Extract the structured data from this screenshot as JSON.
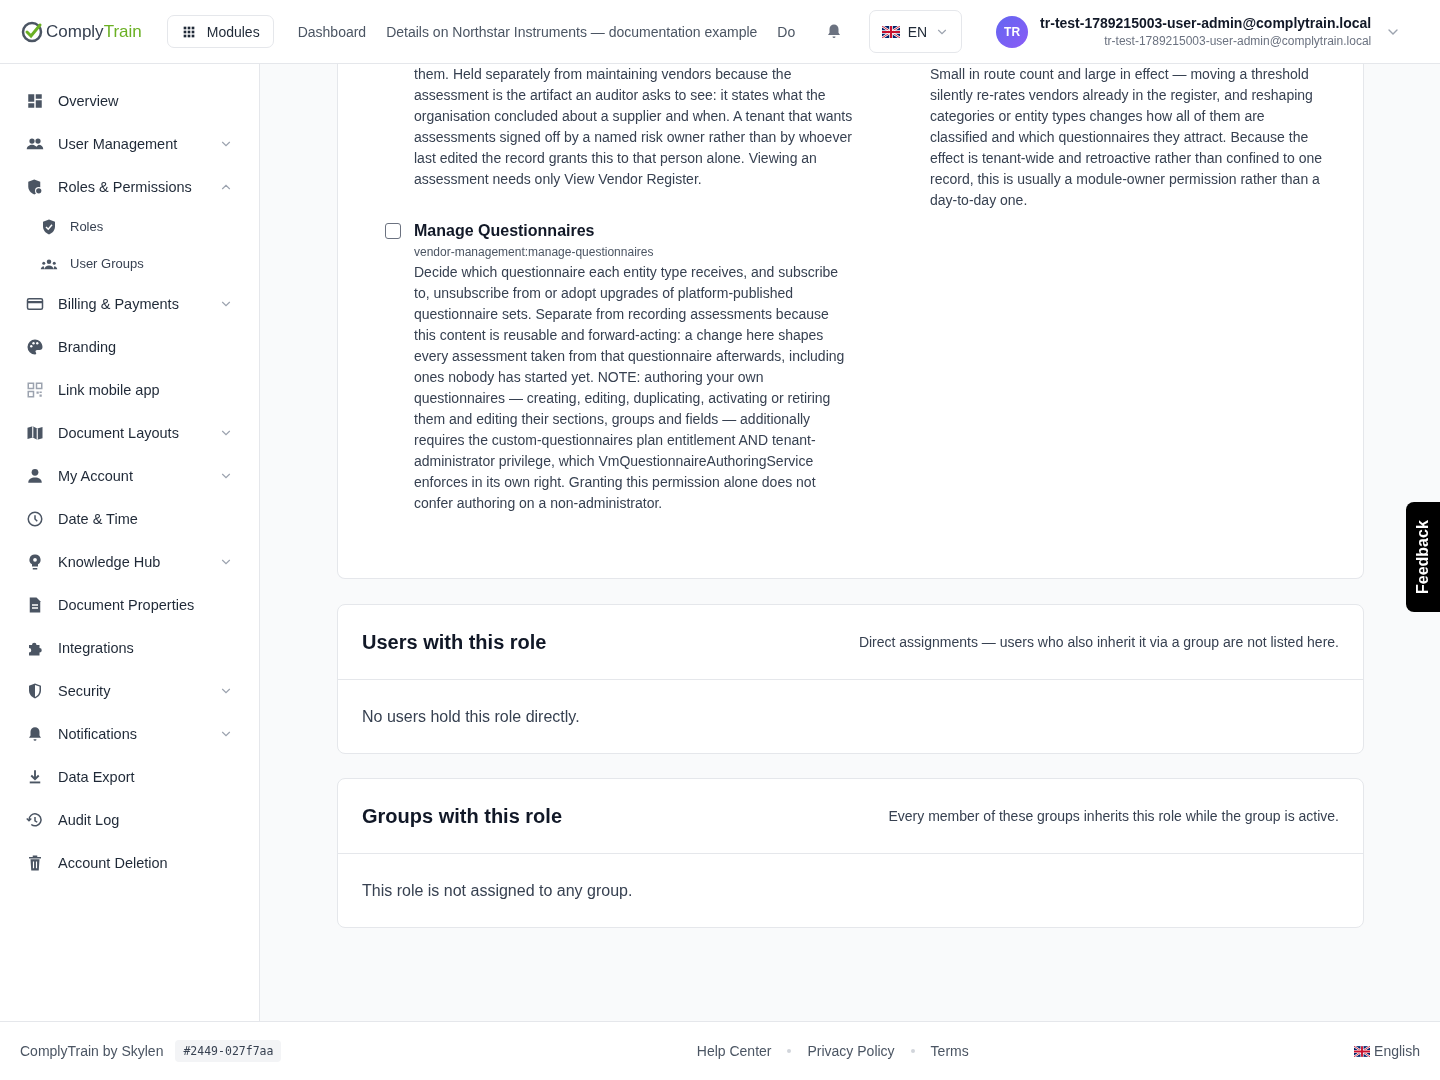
{
  "header": {
    "logo": {
      "dark_part": "Comply",
      "accent_part": "Train"
    },
    "modules_button": "Modules",
    "nav_links": [
      "Dashboard",
      "Details on Northstar Instruments — documentation example",
      "Do"
    ],
    "language": "EN",
    "user": {
      "initials": "TR",
      "name": "tr-test-1789215003-user-admin@complytrain.local",
      "email": "tr-test-1789215003-user-admin@complytrain.local"
    }
  },
  "sidebar": {
    "items": [
      {
        "label": "Overview",
        "kind": "link"
      },
      {
        "label": "User Management",
        "kind": "group",
        "expanded": false
      },
      {
        "label": "Roles & Permissions",
        "kind": "group",
        "expanded": true,
        "children": [
          {
            "label": "Roles"
          },
          {
            "label": "User Groups"
          }
        ]
      },
      {
        "label": "Billing & Payments",
        "kind": "group",
        "expanded": false
      },
      {
        "label": "Branding",
        "kind": "link"
      },
      {
        "label": "Link mobile app",
        "kind": "link"
      },
      {
        "label": "Document Layouts",
        "kind": "group",
        "expanded": false
      },
      {
        "label": "My Account",
        "kind": "group",
        "expanded": false
      },
      {
        "label": "Date & Time",
        "kind": "link"
      },
      {
        "label": "Knowledge Hub",
        "kind": "group",
        "expanded": false
      },
      {
        "label": "Document Properties",
        "kind": "link"
      },
      {
        "label": "Integrations",
        "kind": "link"
      },
      {
        "label": "Security",
        "kind": "group",
        "expanded": false
      },
      {
        "label": "Notifications",
        "kind": "group",
        "expanded": false
      },
      {
        "label": "Data Export",
        "kind": "link"
      },
      {
        "label": "Audit Log",
        "kind": "link"
      },
      {
        "label": "Account Deletion",
        "kind": "link"
      }
    ]
  },
  "permissions": {
    "left_text": "them. Held separately from maintaining vendors because the assessment is the artifact an auditor asks to see: it states what the organisation concluded about a supplier and when. A tenant that wants assessments signed off by a named risk owner rather than by whoever last edited the record grants this to that person alone. Viewing an assessment needs only View Vendor Register.",
    "items": [
      {
        "title": "Manage Questionnaires",
        "key": "vendor-management:manage-questionnaires",
        "description": "Decide which questionnaire each entity type receives, and subscribe to, unsubscribe from or adopt upgrades of platform-published questionnaire sets. Separate from recording assessments because this content is reusable and forward-acting: a change here shapes every assessment taken from that questionnaire afterwards, including ones nobody has started yet. NOTE: authoring your own questionnaires — creating, editing, duplicating, activating or retiring them and editing their sections, groups and fields — additionally requires the custom-questionnaires plan entitlement AND tenant-administrator privilege, which VmQuestionnaireAuthoringService enforces in its own right. Granting this permission alone does not confer authoring on a non-administrator.",
        "checked": false
      }
    ],
    "right_text": "Small in route count and large in effect — moving a threshold silently re-rates vendors already in the register, and reshaping categories or entity types changes how all of them are classified and which questionnaires they attract. Because the effect is tenant-wide and retroactive rather than confined to one record, this is usually a module-owner permission rather than a day-to-day one."
  },
  "role_sections": [
    {
      "title": "Users with this role",
      "note": "Direct assignments — users who also inherit it via a group are not listed here.",
      "empty_message": "No users hold this role directly."
    },
    {
      "title": "Groups with this role",
      "note": "Every member of these groups inherits this role while the group is active.",
      "empty_message": "This role is not assigned to any group."
    }
  ],
  "footer": {
    "brand": "ComplyTrain by Skylen",
    "build": "#2449-027f7aa",
    "links": [
      "Help Center",
      "Privacy Policy",
      "Terms"
    ],
    "language": "English"
  },
  "feedback_tab": "Feedback"
}
